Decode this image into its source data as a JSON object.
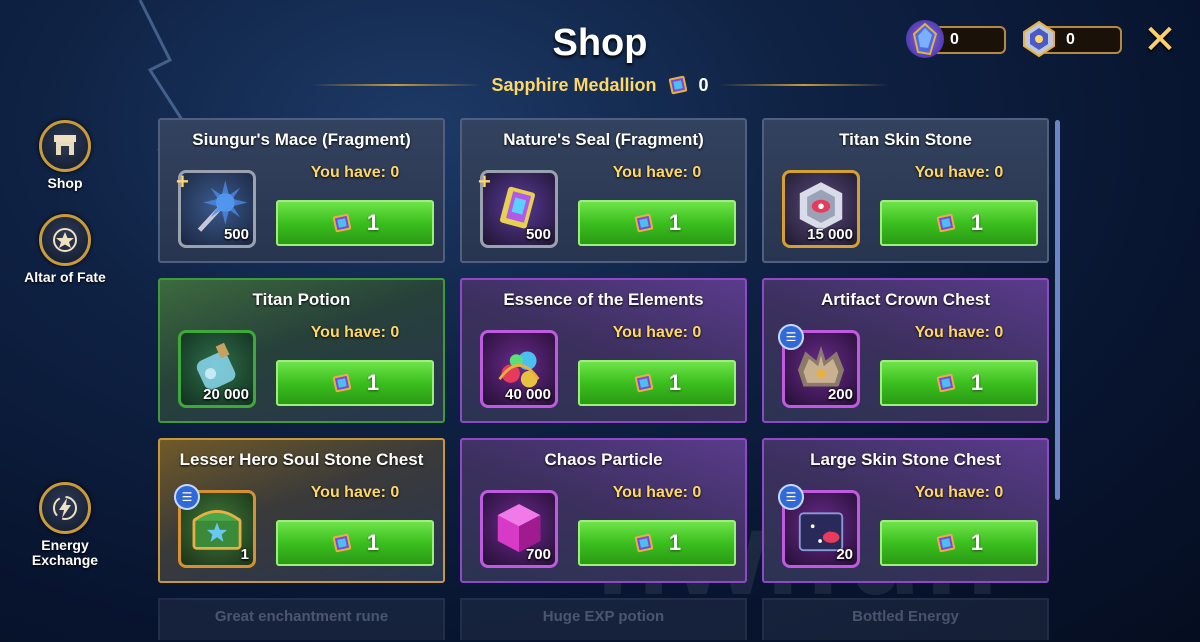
{
  "header": {
    "title": "Shop",
    "currency_name": "Sapphire Medallion",
    "currency_value": "0"
  },
  "resources": [
    {
      "icon": "energy-crystal-icon",
      "value": "0"
    },
    {
      "icon": "emblem-badge-icon",
      "value": "0"
    }
  ],
  "close_label": "✕",
  "sidebar": {
    "items": [
      {
        "label": "Shop",
        "icon": "shop-icon"
      },
      {
        "label": "Altar of Fate",
        "icon": "star-shield-icon"
      },
      {
        "label": "Energy Exchange",
        "icon": "lightning-swap-icon"
      }
    ]
  },
  "cards": [
    {
      "title": "Siungur's Mace (Fragment)",
      "have": "You have: 0",
      "qty": "500",
      "price": "1",
      "icon": "mace-icon",
      "variant": "plain",
      "badge": "plus"
    },
    {
      "title": "Nature's Seal (Fragment)",
      "have": "You have: 0",
      "qty": "500",
      "price": "1",
      "icon": "seal-icon",
      "variant": "plain",
      "badge": "plus"
    },
    {
      "title": "Titan Skin Stone",
      "have": "You have: 0",
      "qty": "15 000",
      "price": "1",
      "icon": "skin-stone-icon",
      "variant": "plain",
      "badge": ""
    },
    {
      "title": "Titan Potion",
      "have": "You have: 0",
      "qty": "20 000",
      "price": "1",
      "icon": "potion-icon",
      "variant": "green",
      "badge": ""
    },
    {
      "title": "Essence of the Elements",
      "have": "You have: 0",
      "qty": "40 000",
      "price": "1",
      "icon": "elements-essence-icon",
      "variant": "purple",
      "badge": ""
    },
    {
      "title": "Artifact Crown Chest",
      "have": "You have: 0",
      "qty": "200",
      "price": "1",
      "icon": "crown-chest-icon",
      "variant": "purple",
      "badge": "list"
    },
    {
      "title": "Lesser Hero Soul Stone Chest",
      "have": "You have: 0",
      "qty": "1",
      "price": "1",
      "icon": "soul-chest-icon",
      "variant": "orange",
      "badge": "list"
    },
    {
      "title": "Chaos Particle",
      "have": "You have: 0",
      "qty": "700",
      "price": "1",
      "icon": "chaos-particle-icon",
      "variant": "purple",
      "badge": ""
    },
    {
      "title": "Large Skin Stone Chest",
      "have": "You have: 0",
      "qty": "20",
      "price": "1",
      "icon": "skin-chest-icon",
      "variant": "purple",
      "badge": "list"
    }
  ],
  "next_row": [
    "Great enchantment rune",
    "Huge EXP potion",
    "Bottled Energy"
  ],
  "watermark": "hw.fun",
  "colors": {
    "buy_green": "#3bbf1f",
    "gold_text": "#ffd766",
    "purple_border": "#9048c8",
    "green_border": "#3f9a3a"
  }
}
